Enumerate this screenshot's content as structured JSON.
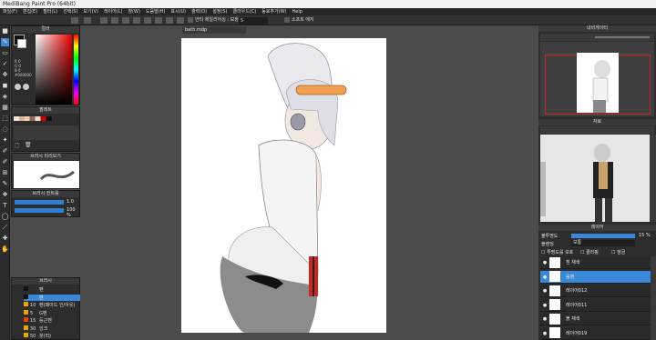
{
  "app": {
    "title": "MediBang Paint Pro (64bit)"
  },
  "menu": [
    "파일(F)",
    "편집(E)",
    "필터(L)",
    "선택(S)",
    "보기(V)",
    "레이어(L)",
    "창(W)",
    "도움말(H)",
    "표시(U)",
    "출력(O)",
    "설정(S)",
    "클라우드(C)",
    "동료추가(W)",
    "Help"
  ],
  "toolbar": {
    "antialias_label": "안티 에일리어싱 : 보정",
    "antialias_value": "5",
    "soft_edge_label": "소프트 에지"
  },
  "left": {
    "color_title": "컬러",
    "palette_title": "팔레트",
    "brush_preview_title": "브러시 미리보기",
    "brush_control_title": "브러시 컨트롤",
    "brush_size": "1.0",
    "opacity_percent": "100 %",
    "rgb": [
      "R 0",
      "G 0",
      "B 0",
      "#000000"
    ],
    "brush_title": "브러시"
  },
  "brushes": [
    {
      "no": "",
      "name": "펜",
      "color": "#111111"
    },
    {
      "no": "",
      "name": "펜",
      "color": "#111111"
    },
    {
      "no": "10",
      "name": "펜(페이드 인/아웃)",
      "color": "#e8a600"
    },
    {
      "no": "5",
      "name": "G펜",
      "color": "#e8a600"
    },
    {
      "no": "15",
      "name": "둥근펜",
      "color": "#e84000"
    },
    {
      "no": "30",
      "name": "잉크",
      "color": "#e8a600"
    },
    {
      "no": "50",
      "name": "붓(직)",
      "color": "#e8a600"
    }
  ],
  "document": {
    "tab": "bath.mdp"
  },
  "right": {
    "navigator_title": "내비게이터",
    "material_title": "자료",
    "layer_title": "레이어",
    "opacity_label": "불투명도",
    "opacity_value": "15 %",
    "blend_label": "블렌딩",
    "blend_value": "보통",
    "protect_label": "투명도를 보호",
    "clip_label": "클리핑",
    "lock_label": "잠금"
  },
  "layers": [
    {
      "name": "흰 채색",
      "selected": false
    },
    {
      "name": "음영",
      "selected": true
    },
    {
      "name": "레이어012",
      "selected": false
    },
    {
      "name": "레이어011",
      "selected": false
    },
    {
      "name": "붉 채색",
      "selected": false
    },
    {
      "name": "레이어019",
      "selected": false
    }
  ],
  "colors": {
    "accent": "#3a89d8",
    "panel": "#2d2d2d",
    "stripe": "#c8281e"
  }
}
